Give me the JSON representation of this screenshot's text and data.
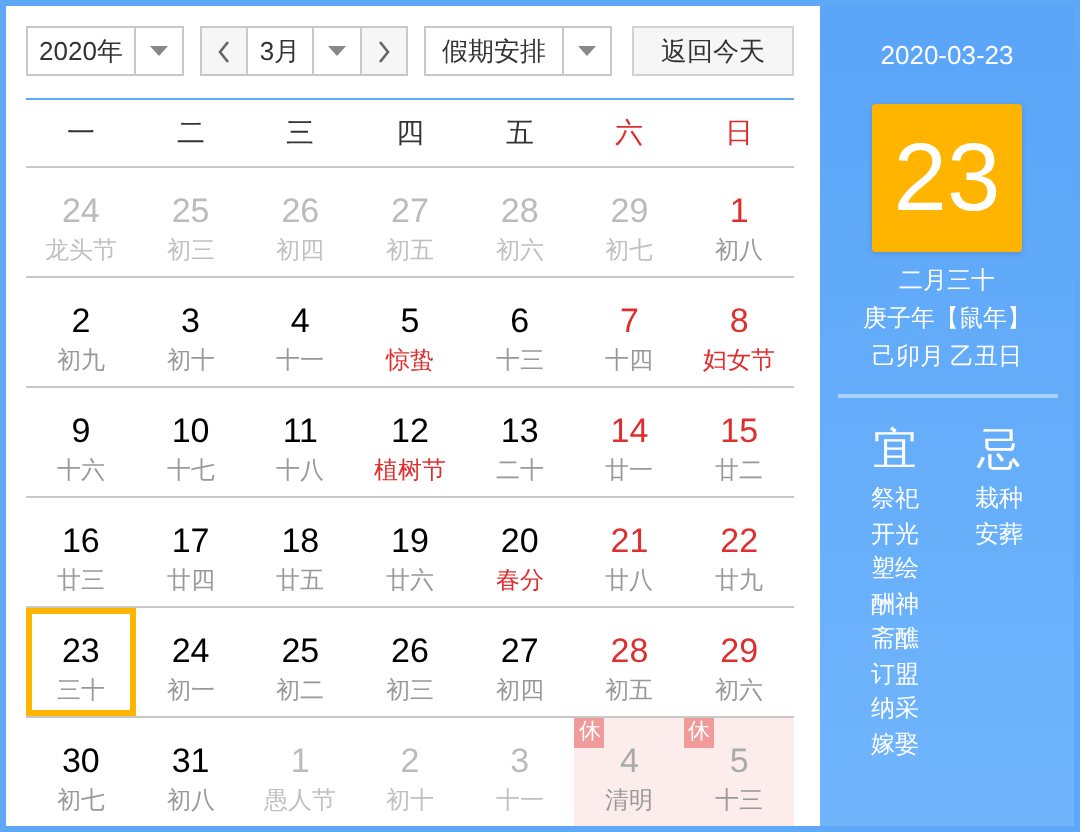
{
  "toolbar": {
    "year": "2020年",
    "month": "3月",
    "holiday": "假期安排",
    "today_button": "返回今天"
  },
  "weekdays": [
    {
      "label": "一",
      "weekend": false
    },
    {
      "label": "二",
      "weekend": false
    },
    {
      "label": "三",
      "weekend": false
    },
    {
      "label": "四",
      "weekend": false
    },
    {
      "label": "五",
      "weekend": false
    },
    {
      "label": "六",
      "weekend": true
    },
    {
      "label": "日",
      "weekend": true
    }
  ],
  "weeks": [
    [
      {
        "day": "24",
        "lunar": "龙头节",
        "other_month": true,
        "weekend": false,
        "festival": false,
        "selected": false
      },
      {
        "day": "25",
        "lunar": "初三",
        "other_month": true,
        "weekend": false,
        "festival": false,
        "selected": false
      },
      {
        "day": "26",
        "lunar": "初四",
        "other_month": true,
        "weekend": false,
        "festival": false,
        "selected": false
      },
      {
        "day": "27",
        "lunar": "初五",
        "other_month": true,
        "weekend": false,
        "festival": false,
        "selected": false
      },
      {
        "day": "28",
        "lunar": "初六",
        "other_month": true,
        "weekend": false,
        "festival": false,
        "selected": false
      },
      {
        "day": "29",
        "lunar": "初七",
        "other_month": true,
        "weekend": false,
        "festival": false,
        "selected": false
      },
      {
        "day": "1",
        "lunar": "初八",
        "other_month": false,
        "weekend": true,
        "festival": false,
        "selected": false
      }
    ],
    [
      {
        "day": "2",
        "lunar": "初九",
        "other_month": false,
        "weekend": false,
        "festival": false,
        "selected": false
      },
      {
        "day": "3",
        "lunar": "初十",
        "other_month": false,
        "weekend": false,
        "festival": false,
        "selected": false
      },
      {
        "day": "4",
        "lunar": "十一",
        "other_month": false,
        "weekend": false,
        "festival": false,
        "selected": false
      },
      {
        "day": "5",
        "lunar": "惊蛰",
        "other_month": false,
        "weekend": false,
        "festival": true,
        "selected": false
      },
      {
        "day": "6",
        "lunar": "十三",
        "other_month": false,
        "weekend": false,
        "festival": false,
        "selected": false
      },
      {
        "day": "7",
        "lunar": "十四",
        "other_month": false,
        "weekend": true,
        "festival": false,
        "selected": false
      },
      {
        "day": "8",
        "lunar": "妇女节",
        "other_month": false,
        "weekend": true,
        "festival": true,
        "selected": false
      }
    ],
    [
      {
        "day": "9",
        "lunar": "十六",
        "other_month": false,
        "weekend": false,
        "festival": false,
        "selected": false
      },
      {
        "day": "10",
        "lunar": "十七",
        "other_month": false,
        "weekend": false,
        "festival": false,
        "selected": false
      },
      {
        "day": "11",
        "lunar": "十八",
        "other_month": false,
        "weekend": false,
        "festival": false,
        "selected": false
      },
      {
        "day": "12",
        "lunar": "植树节",
        "other_month": false,
        "weekend": false,
        "festival": true,
        "selected": false
      },
      {
        "day": "13",
        "lunar": "二十",
        "other_month": false,
        "weekend": false,
        "festival": false,
        "selected": false
      },
      {
        "day": "14",
        "lunar": "廿一",
        "other_month": false,
        "weekend": true,
        "festival": false,
        "selected": false
      },
      {
        "day": "15",
        "lunar": "廿二",
        "other_month": false,
        "weekend": true,
        "festival": false,
        "selected": false
      }
    ],
    [
      {
        "day": "16",
        "lunar": "廿三",
        "other_month": false,
        "weekend": false,
        "festival": false,
        "selected": false
      },
      {
        "day": "17",
        "lunar": "廿四",
        "other_month": false,
        "weekend": false,
        "festival": false,
        "selected": false
      },
      {
        "day": "18",
        "lunar": "廿五",
        "other_month": false,
        "weekend": false,
        "festival": false,
        "selected": false
      },
      {
        "day": "19",
        "lunar": "廿六",
        "other_month": false,
        "weekend": false,
        "festival": false,
        "selected": false
      },
      {
        "day": "20",
        "lunar": "春分",
        "other_month": false,
        "weekend": false,
        "festival": true,
        "selected": false
      },
      {
        "day": "21",
        "lunar": "廿八",
        "other_month": false,
        "weekend": true,
        "festival": false,
        "selected": false
      },
      {
        "day": "22",
        "lunar": "廿九",
        "other_month": false,
        "weekend": true,
        "festival": false,
        "selected": false
      }
    ],
    [
      {
        "day": "23",
        "lunar": "三十",
        "other_month": false,
        "weekend": false,
        "festival": false,
        "selected": true
      },
      {
        "day": "24",
        "lunar": "初一",
        "other_month": false,
        "weekend": false,
        "festival": false,
        "selected": false
      },
      {
        "day": "25",
        "lunar": "初二",
        "other_month": false,
        "weekend": false,
        "festival": false,
        "selected": false
      },
      {
        "day": "26",
        "lunar": "初三",
        "other_month": false,
        "weekend": false,
        "festival": false,
        "selected": false
      },
      {
        "day": "27",
        "lunar": "初四",
        "other_month": false,
        "weekend": false,
        "festival": false,
        "selected": false
      },
      {
        "day": "28",
        "lunar": "初五",
        "other_month": false,
        "weekend": true,
        "festival": false,
        "selected": false
      },
      {
        "day": "29",
        "lunar": "初六",
        "other_month": false,
        "weekend": true,
        "festival": false,
        "selected": false
      }
    ],
    [
      {
        "day": "30",
        "lunar": "初七",
        "other_month": false,
        "weekend": false,
        "festival": false,
        "selected": false
      },
      {
        "day": "31",
        "lunar": "初八",
        "other_month": false,
        "weekend": false,
        "festival": false,
        "selected": false
      },
      {
        "day": "1",
        "lunar": "愚人节",
        "other_month": true,
        "weekend": false,
        "festival": false,
        "selected": false
      },
      {
        "day": "2",
        "lunar": "初十",
        "other_month": true,
        "weekend": false,
        "festival": false,
        "selected": false
      },
      {
        "day": "3",
        "lunar": "十一",
        "other_month": true,
        "weekend": false,
        "festival": false,
        "selected": false
      },
      {
        "day": "4",
        "lunar": "清明",
        "other_month": true,
        "weekend": false,
        "festival": false,
        "selected": false,
        "badge": "休"
      },
      {
        "day": "5",
        "lunar": "十三",
        "other_month": true,
        "weekend": false,
        "festival": false,
        "selected": false,
        "badge": "休"
      }
    ]
  ],
  "sidebar": {
    "date": "2020-03-23",
    "day": "23",
    "lunar_date": "二月三十",
    "year_line": "庚子年【鼠年】",
    "month_day": "己卯月 乙丑日",
    "good": {
      "title": "宜",
      "items": [
        "祭祀",
        "开光",
        "塑绘",
        "酬神",
        "斋醮",
        "订盟",
        "纳采",
        "嫁娶"
      ]
    },
    "bad": {
      "title": "忌",
      "items": [
        "栽种",
        "安葬"
      ]
    }
  }
}
